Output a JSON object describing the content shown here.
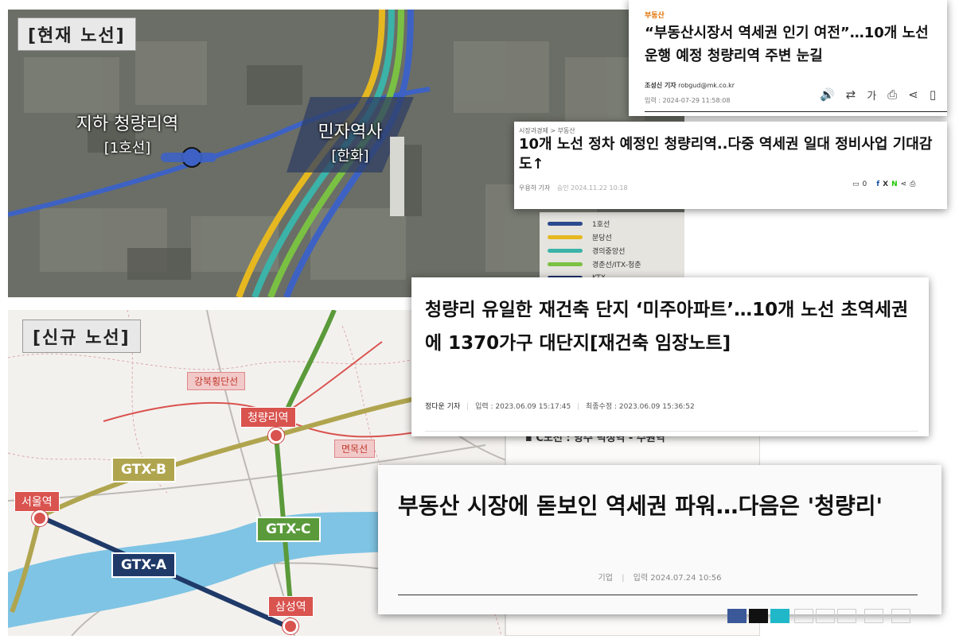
{
  "aerial_map": {
    "tag": "[현재 노선]",
    "station_underground": {
      "name": "지하 청량리역",
      "sub": "[1호선]"
    },
    "station_private": {
      "name": "민자역사",
      "sub": "[한화]"
    },
    "legend": [
      {
        "label": "1호선",
        "color": "#2b4a8e"
      },
      {
        "label": "분당선",
        "color": "#e6b820"
      },
      {
        "label": "경의중앙선",
        "color": "#3bb3a8"
      },
      {
        "label": "경춘선/ITX-청춘",
        "color": "#7ac143"
      },
      {
        "label": "KTX",
        "color": "#1d2f6b"
      }
    ]
  },
  "route_map": {
    "tag": "[신규 노선]",
    "lines": {
      "gtx_a": {
        "label": "GTX-A",
        "color": "#1f3a68"
      },
      "gtx_b": {
        "label": "GTX-B",
        "color": "#b0a54f"
      },
      "gtx_c": {
        "label": "GTX-C",
        "color": "#5a9a3a"
      }
    },
    "stations": {
      "cheongnyangni": "청량리역",
      "seoul": "서울역",
      "samseong": "삼성역"
    },
    "other_lines": {
      "gangbuk": "강북횡단선",
      "myeonmok": "면목선"
    },
    "note": "▪ C노선 : 양주 덕정역 - 수원역"
  },
  "articles": [
    {
      "section": "부동산",
      "headline": "“부동산시장서 역세권 인기 여전”…10개 노선 운행 예정 청량리역 주변 눈길",
      "reporter": "조성신 기자",
      "email": "robgud@mk.co.kr",
      "date": "입력 : 2024-07-29 11:58:08",
      "font_size_label": "가"
    },
    {
      "breadcrumb": "시장과경제 > 부동산",
      "headline": "10개 노선 정차 예정인 청량리역..다중 역세권 일대 정비사업 기대감도↑",
      "reporter": "우용하 기자",
      "date": "승인 2024.11.22 10:18",
      "comments": "0"
    },
    {
      "headline": "청량리 유일한 재건축 단지 ‘미주아파트’…10개 노선 초역세권에 1370가구 대단지[재건축 임장노트]",
      "reporter": "정다운 기자",
      "input_date": "입력 : 2023.06.09 15:17:45",
      "updated_date": "최종수정 : 2023.06.09 15:36:52"
    },
    {
      "headline": "부동산 시장에 돋보인 역세권 파워…다음은 '청량리'",
      "category": "기업",
      "date": "입력 2024.07.24 10:56"
    }
  ]
}
